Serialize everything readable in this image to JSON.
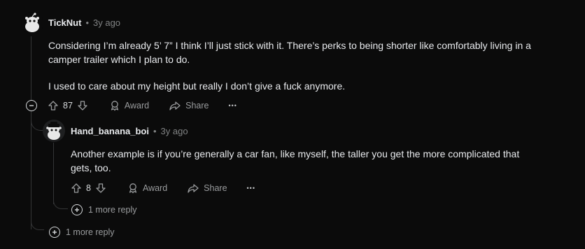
{
  "comment": {
    "author": "TickNut",
    "separator": "•",
    "time": "3y ago",
    "paragraphs": [
      "Considering I’m already 5’ 7” I think I’ll just stick with it. There’s perks to being shorter like comfortably living in a camper trailer which I plan to do.",
      "I used to care about my height but really I don’t give a fuck anymore."
    ],
    "votes": "87",
    "award_label": "Award",
    "share_label": "Share",
    "more_label": "•••",
    "more_replies_label": "1 more reply"
  },
  "reply": {
    "author": "Hand_banana_boi",
    "separator": "•",
    "time": "3y ago",
    "paragraphs": [
      "Another example is if you’re generally a car fan, like myself, the taller you get the more complicated that gets, too."
    ],
    "votes": "8",
    "award_label": "Award",
    "share_label": "Share",
    "more_label": "•••",
    "more_replies_label": "1 more reply"
  },
  "icons": {
    "collapse": "minus-circle-icon",
    "upvote": "arrow-up-icon",
    "downvote": "arrow-down-icon",
    "award": "award-icon",
    "share": "share-icon",
    "overflow": "ellipsis-icon",
    "expand": "plus-circle-icon"
  }
}
